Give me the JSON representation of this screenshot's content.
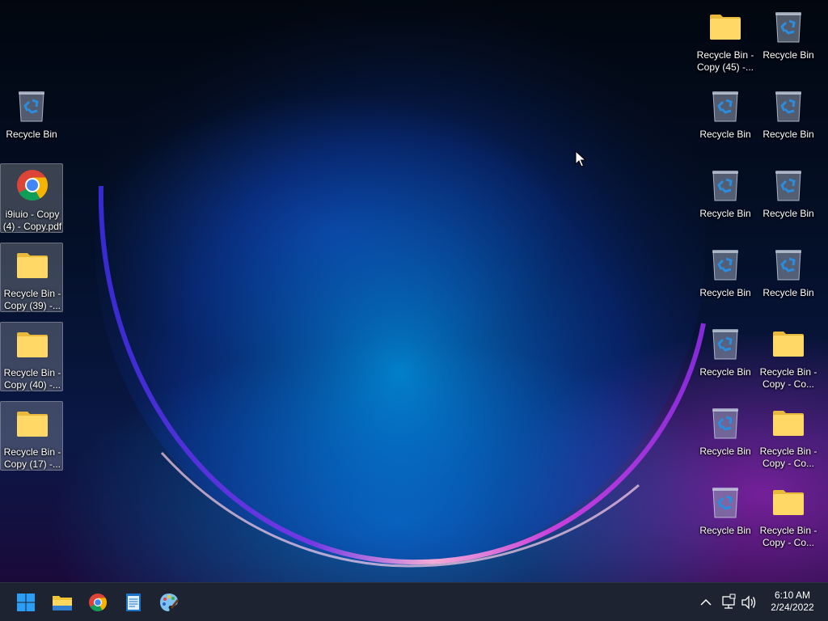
{
  "desktop": {
    "icons_left": [
      {
        "label": "Recycle Bin",
        "icon": "recycle-bin-icon",
        "selected": false
      },
      {
        "label": "i9iuio - Copy (4) - Copy.pdf",
        "icon": "chrome-pdf-icon",
        "selected": true
      },
      {
        "label": "Recycle Bin - Copy (39) -...",
        "icon": "folder-icon",
        "selected": true
      },
      {
        "label": "Recycle Bin - Copy (40) -...",
        "icon": "folder-icon",
        "selected": true
      },
      {
        "label": "Recycle Bin - Copy (17) -...",
        "icon": "folder-icon",
        "selected": true
      }
    ],
    "icons_right_col1": [
      {
        "label": "Recycle Bin - Copy (45) -...",
        "icon": "folder-icon"
      },
      {
        "label": "Recycle Bin",
        "icon": "recycle-bin-icon"
      },
      {
        "label": "Recycle Bin",
        "icon": "recycle-bin-icon"
      },
      {
        "label": "Recycle Bin",
        "icon": "recycle-bin-icon"
      },
      {
        "label": "Recycle Bin",
        "icon": "recycle-bin-icon"
      },
      {
        "label": "Recycle Bin",
        "icon": "recycle-bin-icon"
      },
      {
        "label": "Recycle Bin",
        "icon": "recycle-bin-icon"
      }
    ],
    "icons_right_col2": [
      {
        "label": "Recycle Bin",
        "icon": "recycle-bin-icon"
      },
      {
        "label": "Recycle Bin",
        "icon": "recycle-bin-icon"
      },
      {
        "label": "Recycle Bin",
        "icon": "recycle-bin-icon"
      },
      {
        "label": "Recycle Bin",
        "icon": "recycle-bin-icon"
      },
      {
        "label": "Recycle Bin - Copy - Co...",
        "icon": "folder-icon"
      },
      {
        "label": "Recycle Bin - Copy - Co...",
        "icon": "folder-icon"
      },
      {
        "label": "Recycle Bin - Copy - Co...",
        "icon": "folder-icon"
      }
    ]
  },
  "taskbar": {
    "apps": [
      {
        "name": "start-button",
        "icon": "windows-logo-icon"
      },
      {
        "name": "file-explorer-button",
        "icon": "folder-icon"
      },
      {
        "name": "chrome-button",
        "icon": "chrome-icon"
      },
      {
        "name": "notepad-button",
        "icon": "notepad-icon"
      },
      {
        "name": "paint-button",
        "icon": "paint-palette-icon"
      }
    ],
    "tray": {
      "chevron_icon": "chevron-up-icon",
      "network_icon": "network-icon",
      "volume_icon": "volume-icon",
      "time": "6:10 AM",
      "date": "2/24/2022"
    }
  },
  "colors": {
    "taskbar_bg": "#1d2330",
    "folder_yellow": "#f7d35c",
    "windows_blue": "#1f9cf0"
  }
}
